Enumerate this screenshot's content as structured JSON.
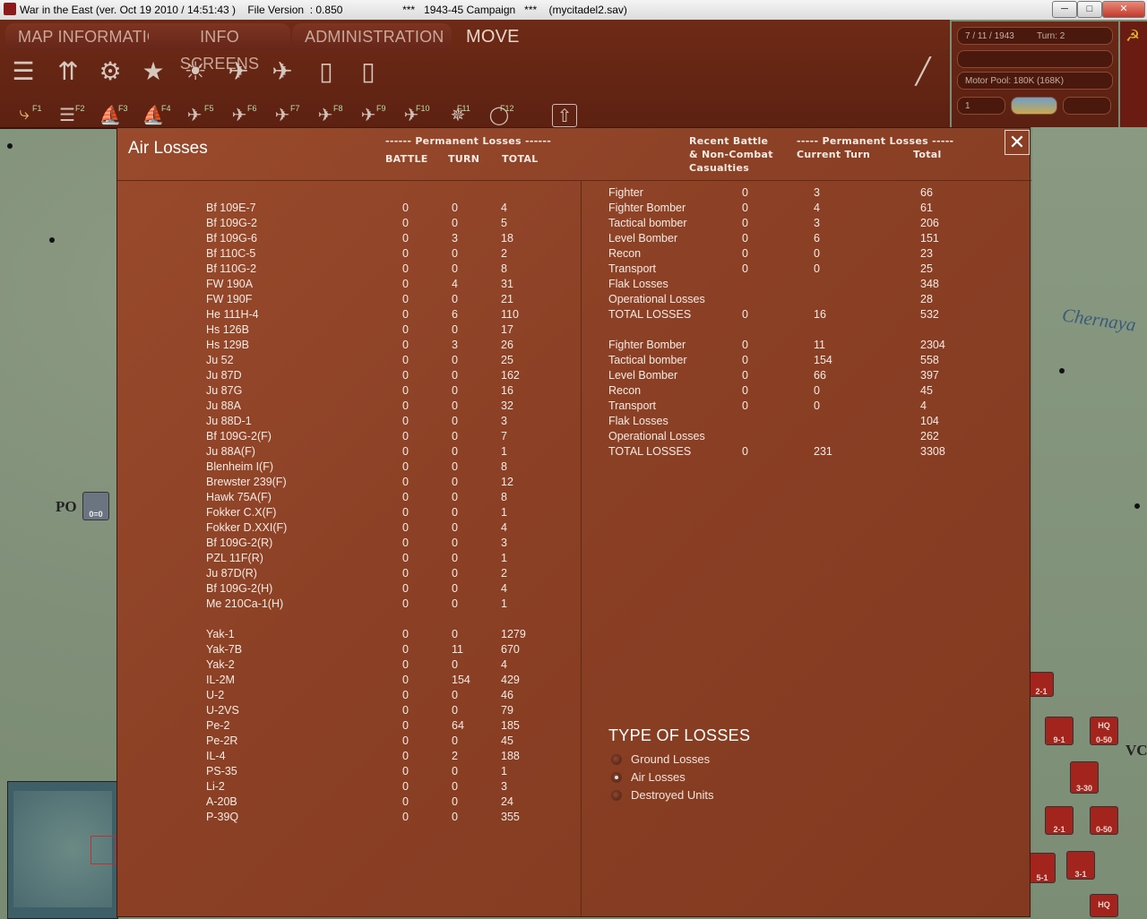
{
  "window": {
    "title": "War in the East (ver. Oct 19 2010 / 14:51:43 )    File Version  : 0.850                    ***   1943-45 Campaign   ***    (mycitadel2.sav)"
  },
  "menu": {
    "tabs": [
      "MAP INFORMATION",
      "INFO SCREENS",
      "ADMINISTRATION"
    ],
    "mode": "MOVE"
  },
  "fkeys": [
    "F1",
    "F2",
    "F3",
    "F4",
    "F5",
    "F6",
    "F7",
    "F8",
    "F9",
    "F10",
    "F11",
    "F12"
  ],
  "info": {
    "date": "7 / 11 / 1943",
    "turn": "Turn:  2",
    "motor_pool": "Motor Pool:  180K  (168K)",
    "field_one": "1"
  },
  "map": {
    "river": "Chernaya",
    "label_po": "PO",
    "label_vc": "VC",
    "counters": [
      "0=0",
      "2-1",
      "9-1",
      "0-50",
      "3-30",
      "2-1",
      "0-50",
      "3-1",
      "5-1",
      "HQ",
      "HQ"
    ]
  },
  "dialog": {
    "title": "Air Losses",
    "left_header": {
      "group": "------ Permanent Losses ------",
      "battle": "BATTLE",
      "turn": "TURN",
      "total": "TOTAL"
    },
    "right_header": {
      "recent1": "Recent Battle",
      "recent2": "& Non-Combat",
      "recent3": "Casualties",
      "group": "----- Permanent Losses -----",
      "current": "Current Turn",
      "total": "Total"
    },
    "axis_aircraft": [
      {
        "name": "Bf 109E-7",
        "battle": "0",
        "turn": "0",
        "total": "4"
      },
      {
        "name": "Bf 109G-2",
        "battle": "0",
        "turn": "0",
        "total": "5"
      },
      {
        "name": "Bf 109G-6",
        "battle": "0",
        "turn": "3",
        "total": "18"
      },
      {
        "name": "Bf 110C-5",
        "battle": "0",
        "turn": "0",
        "total": "2"
      },
      {
        "name": "Bf 110G-2",
        "battle": "0",
        "turn": "0",
        "total": "8"
      },
      {
        "name": "FW 190A",
        "battle": "0",
        "turn": "4",
        "total": "31"
      },
      {
        "name": "FW 190F",
        "battle": "0",
        "turn": "0",
        "total": "21"
      },
      {
        "name": "He 111H-4",
        "battle": "0",
        "turn": "6",
        "total": "110"
      },
      {
        "name": "Hs 126B",
        "battle": "0",
        "turn": "0",
        "total": "17"
      },
      {
        "name": "Hs 129B",
        "battle": "0",
        "turn": "3",
        "total": "26"
      },
      {
        "name": "Ju 52",
        "battle": "0",
        "turn": "0",
        "total": "25"
      },
      {
        "name": "Ju 87D",
        "battle": "0",
        "turn": "0",
        "total": "162"
      },
      {
        "name": "Ju 87G",
        "battle": "0",
        "turn": "0",
        "total": "16"
      },
      {
        "name": "Ju 88A",
        "battle": "0",
        "turn": "0",
        "total": "32"
      },
      {
        "name": "Ju 88D-1",
        "battle": "0",
        "turn": "0",
        "total": "3"
      },
      {
        "name": "Bf 109G-2(F)",
        "battle": "0",
        "turn": "0",
        "total": "7"
      },
      {
        "name": "Ju 88A(F)",
        "battle": "0",
        "turn": "0",
        "total": "1"
      },
      {
        "name": "Blenheim I(F)",
        "battle": "0",
        "turn": "0",
        "total": "8"
      },
      {
        "name": "Brewster 239(F)",
        "battle": "0",
        "turn": "0",
        "total": "12"
      },
      {
        "name": "Hawk 75A(F)",
        "battle": "0",
        "turn": "0",
        "total": "8"
      },
      {
        "name": "Fokker C.X(F)",
        "battle": "0",
        "turn": "0",
        "total": "1"
      },
      {
        "name": "Fokker D.XXI(F)",
        "battle": "0",
        "turn": "0",
        "total": "4"
      },
      {
        "name": "Bf 109G-2(R)",
        "battle": "0",
        "turn": "0",
        "total": "3"
      },
      {
        "name": "PZL 11F(R)",
        "battle": "0",
        "turn": "0",
        "total": "1"
      },
      {
        "name": "Ju 87D(R)",
        "battle": "0",
        "turn": "0",
        "total": "2"
      },
      {
        "name": "Bf 109G-2(H)",
        "battle": "0",
        "turn": "0",
        "total": "4"
      },
      {
        "name": "Me 210Ca-1(H)",
        "battle": "0",
        "turn": "0",
        "total": "1"
      }
    ],
    "soviet_aircraft": [
      {
        "name": "Yak-1",
        "battle": "0",
        "turn": "0",
        "total": "1279"
      },
      {
        "name": "Yak-7B",
        "battle": "0",
        "turn": "11",
        "total": "670"
      },
      {
        "name": "Yak-2",
        "battle": "0",
        "turn": "0",
        "total": "4"
      },
      {
        "name": "IL-2M",
        "battle": "0",
        "turn": "154",
        "total": "429"
      },
      {
        "name": "U-2",
        "battle": "0",
        "turn": "0",
        "total": "46"
      },
      {
        "name": "U-2VS",
        "battle": "0",
        "turn": "0",
        "total": "79"
      },
      {
        "name": "Pe-2",
        "battle": "0",
        "turn": "64",
        "total": "185"
      },
      {
        "name": "Pe-2R",
        "battle": "0",
        "turn": "0",
        "total": "45"
      },
      {
        "name": "IL-4",
        "battle": "0",
        "turn": "2",
        "total": "188"
      },
      {
        "name": "PS-35",
        "battle": "0",
        "turn": "0",
        "total": "1"
      },
      {
        "name": "Li-2",
        "battle": "0",
        "turn": "0",
        "total": "3"
      },
      {
        "name": "A-20B",
        "battle": "0",
        "turn": "0",
        "total": "24"
      },
      {
        "name": "P-39Q",
        "battle": "0",
        "turn": "0",
        "total": "355"
      }
    ],
    "axis_summary": [
      {
        "type": "Fighter",
        "recent": "0",
        "current": "3",
        "total": "66"
      },
      {
        "type": "Fighter Bomber",
        "recent": "0",
        "current": "4",
        "total": "61"
      },
      {
        "type": "Tactical bomber",
        "recent": "0",
        "current": "3",
        "total": "206"
      },
      {
        "type": "Level Bomber",
        "recent": "0",
        "current": "6",
        "total": "151"
      },
      {
        "type": "Recon",
        "recent": "0",
        "current": "0",
        "total": "23"
      },
      {
        "type": "Transport",
        "recent": "0",
        "current": "0",
        "total": "25"
      },
      {
        "type": "Flak Losses",
        "recent": "",
        "current": "",
        "total": "348"
      },
      {
        "type": "Operational Losses",
        "recent": "",
        "current": "",
        "total": "28"
      },
      {
        "type": "TOTAL LOSSES",
        "recent": "0",
        "current": "16",
        "total": "532"
      }
    ],
    "soviet_summary": [
      {
        "type": "Fighter Bomber",
        "recent": "0",
        "current": "11",
        "total": "2304"
      },
      {
        "type": "Tactical bomber",
        "recent": "0",
        "current": "154",
        "total": "558"
      },
      {
        "type": "Level Bomber",
        "recent": "0",
        "current": "66",
        "total": "397"
      },
      {
        "type": "Recon",
        "recent": "0",
        "current": "0",
        "total": "45"
      },
      {
        "type": "Transport",
        "recent": "0",
        "current": "0",
        "total": "4"
      },
      {
        "type": "Flak Losses",
        "recent": "",
        "current": "",
        "total": "104"
      },
      {
        "type": "Operational Losses",
        "recent": "",
        "current": "",
        "total": "262"
      },
      {
        "type": "TOTAL LOSSES",
        "recent": "0",
        "current": "231",
        "total": "3308"
      }
    ],
    "types": {
      "title": "TYPE OF LOSSES",
      "options": [
        "Ground Losses",
        "Air Losses",
        "Destroyed Units"
      ],
      "selected": "Air Losses"
    }
  }
}
